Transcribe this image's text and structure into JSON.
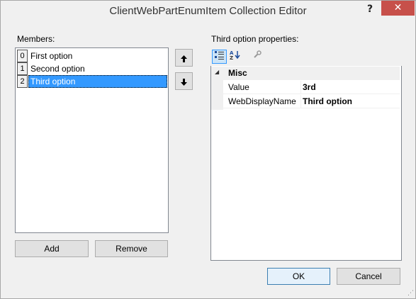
{
  "window": {
    "title": "ClientWebPartEnumItem Collection Editor",
    "help_label": "?",
    "close_label": "✕"
  },
  "members": {
    "label": "Members:",
    "items": [
      {
        "index": "0",
        "label": "First option"
      },
      {
        "index": "1",
        "label": "Second option"
      },
      {
        "index": "2",
        "label": "Third option"
      }
    ],
    "selected_index": 2,
    "add_label": "Add",
    "remove_label": "Remove",
    "move_up_icon": "arrow-up-icon",
    "move_down_icon": "arrow-down-icon"
  },
  "properties": {
    "label": "Third option properties:",
    "toolbar": {
      "categorized_icon": "categorized-icon",
      "alphabetical_icon": "alphabetical-sort-icon",
      "property_pages_icon": "wrench-icon"
    },
    "category": "Misc",
    "rows": [
      {
        "name": "Value",
        "value": "3rd"
      },
      {
        "name": "WebDisplayName",
        "value": "Third option"
      }
    ]
  },
  "footer": {
    "ok_label": "OK",
    "cancel_label": "Cancel"
  },
  "colors": {
    "selection": "#3399ff",
    "close_button": "#c7504a",
    "dialog_background": "#f0f0f0"
  }
}
